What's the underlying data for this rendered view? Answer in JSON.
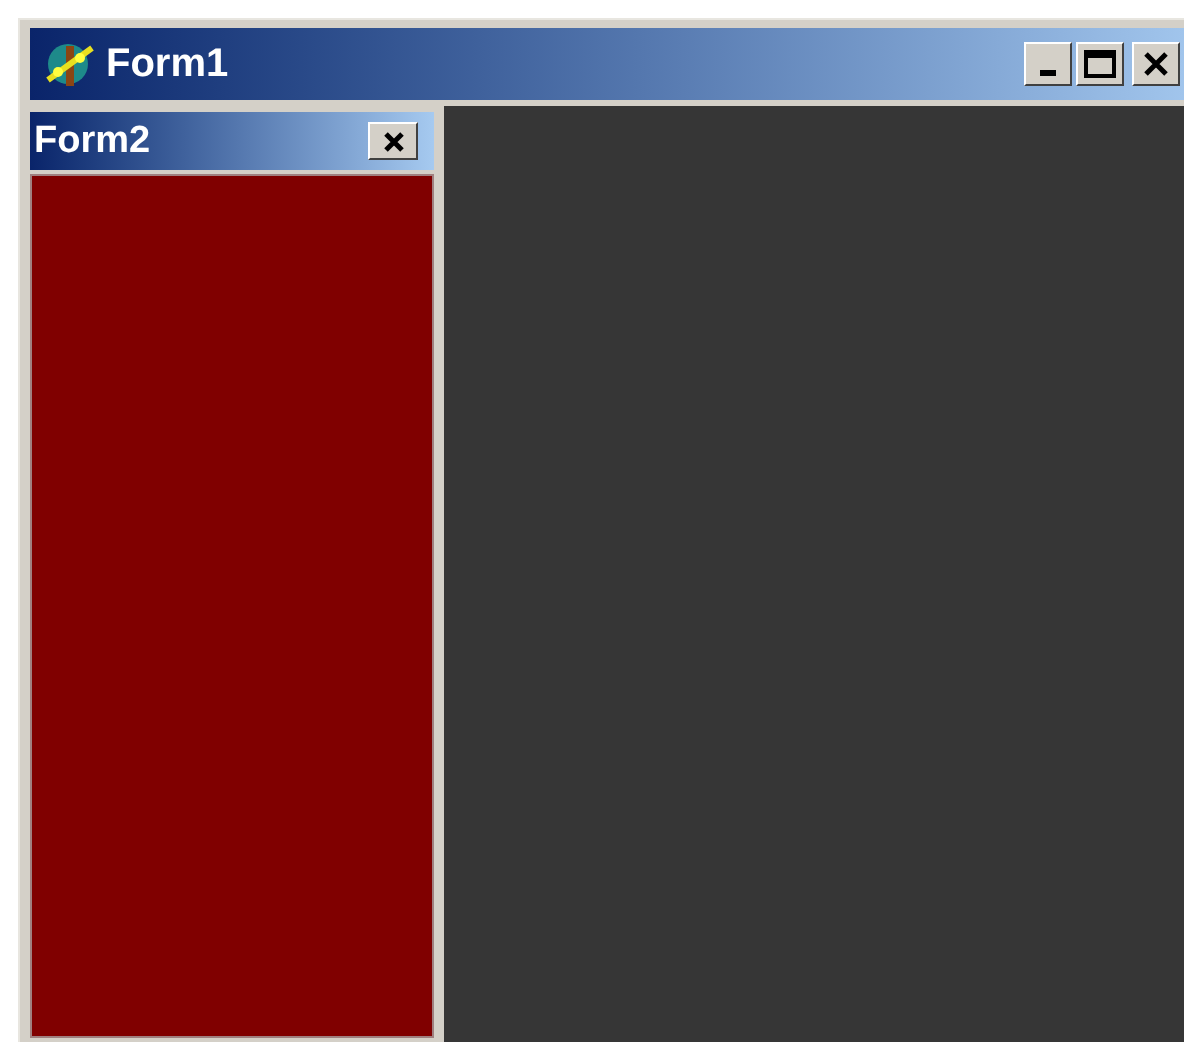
{
  "window": {
    "title": "Form1"
  },
  "docked_form": {
    "title": "Form2"
  }
}
